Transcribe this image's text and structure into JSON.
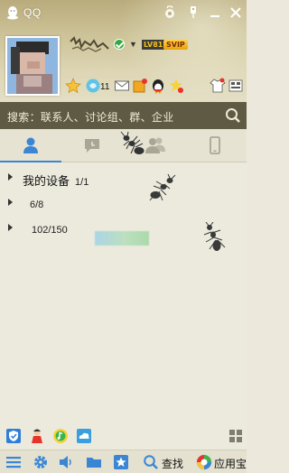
{
  "window": {
    "title": "QQ",
    "controls": [
      "skin-icon",
      "pin-icon",
      "minimize-icon",
      "close-icon"
    ]
  },
  "profile": {
    "level_badge": "LV81",
    "vip_badge": "SVIP",
    "unread_count": "11",
    "status": "online"
  },
  "search": {
    "placeholder": "搜索：联系人、讨论组、群、企业"
  },
  "tabs": [
    {
      "icon": "contacts-icon",
      "active": true
    },
    {
      "icon": "recent-chats-icon",
      "active": false
    },
    {
      "icon": "groups-icon",
      "active": false
    },
    {
      "icon": "phone-icon",
      "active": false
    }
  ],
  "groups": [
    {
      "name": "我的设备",
      "count": "1/1"
    },
    {
      "name": "",
      "count": "6/8"
    },
    {
      "name": "",
      "count": "102/150"
    }
  ],
  "bottom": {
    "search_label": "查找",
    "appbox_label": "应用宝"
  },
  "colors": {
    "accent": "#3a86d4",
    "search_bar": "#5f5a44",
    "online": "#2ea93a",
    "list_bg": "#eceadc"
  }
}
